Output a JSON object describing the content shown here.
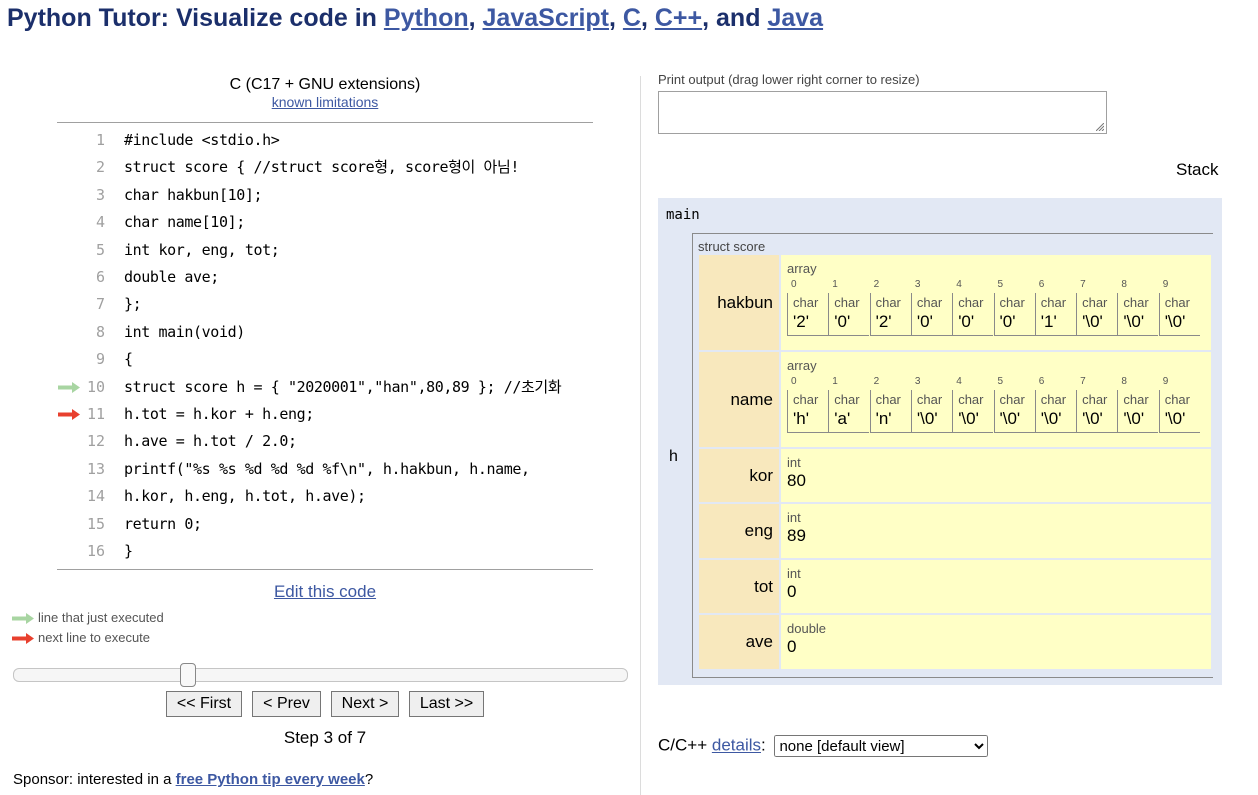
{
  "header": {
    "prefix": "Python Tutor: Visualize code in ",
    "links": [
      "Python",
      "JavaScript",
      "C",
      "C++",
      "Java"
    ],
    "sep": ", ",
    "and": ", and "
  },
  "editor": {
    "language": "C (C17 + GNU extensions)",
    "limitations_link": "known limitations",
    "lines": [
      {
        "n": "1",
        "code": "#include <stdio.h>"
      },
      {
        "n": "2",
        "code": "struct score { //struct score형, score형이 아님!"
      },
      {
        "n": "3",
        "code": "char hakbun[10];"
      },
      {
        "n": "4",
        "code": "char name[10];"
      },
      {
        "n": "5",
        "code": "int kor, eng, tot;"
      },
      {
        "n": "6",
        "code": "double ave;"
      },
      {
        "n": "7",
        "code": "};"
      },
      {
        "n": "8",
        "code": "int main(void)"
      },
      {
        "n": "9",
        "code": "{"
      },
      {
        "n": "10",
        "code": "struct score h = { \"2020001\",\"han\",80,89 }; //초기화"
      },
      {
        "n": "11",
        "code": "h.tot = h.kor + h.eng;"
      },
      {
        "n": "12",
        "code": "h.ave = h.tot / 2.0;"
      },
      {
        "n": "13",
        "code": "printf(\"%s %s %d %d %d %f\\n\", h.hakbun, h.name,"
      },
      {
        "n": "14",
        "code": "h.kor, h.eng, h.tot, h.ave);"
      },
      {
        "n": "15",
        "code": "return 0;"
      },
      {
        "n": "16",
        "code": "}"
      }
    ],
    "edit_link": "Edit this code"
  },
  "legend": {
    "executed": "line that just executed",
    "next": "next line to execute",
    "executed_color": "#a8d5a2",
    "next_color": "#e8402e"
  },
  "navigation": {
    "first": "<< First",
    "prev": "< Prev",
    "next": "Next >",
    "last": "Last >>",
    "step_text": "Step 3 of 7",
    "current_step": 3,
    "total_steps": 7
  },
  "sponsor": {
    "prefix": "Sponsor: interested in a ",
    "link": "free Python tip every week",
    "suffix": "?"
  },
  "output": {
    "print_label": "Print output (drag lower right corner to resize)",
    "print_value": "",
    "stack_label": "Stack"
  },
  "frame": {
    "name": "main",
    "var_name": "h",
    "struct_type": "struct score",
    "fields": [
      {
        "name": "hakbun",
        "kind": "array",
        "type_label": "array",
        "cells": [
          {
            "idx": "0",
            "type": "char",
            "val": "'2'"
          },
          {
            "idx": "1",
            "type": "char",
            "val": "'0'"
          },
          {
            "idx": "2",
            "type": "char",
            "val": "'2'"
          },
          {
            "idx": "3",
            "type": "char",
            "val": "'0'"
          },
          {
            "idx": "4",
            "type": "char",
            "val": "'0'"
          },
          {
            "idx": "5",
            "type": "char",
            "val": "'0'"
          },
          {
            "idx": "6",
            "type": "char",
            "val": "'1'"
          },
          {
            "idx": "7",
            "type": "char",
            "val": "'\\0'"
          },
          {
            "idx": "8",
            "type": "char",
            "val": "'\\0'"
          },
          {
            "idx": "9",
            "type": "char",
            "val": "'\\0'"
          }
        ]
      },
      {
        "name": "name",
        "kind": "array",
        "type_label": "array",
        "cells": [
          {
            "idx": "0",
            "type": "char",
            "val": "'h'"
          },
          {
            "idx": "1",
            "type": "char",
            "val": "'a'"
          },
          {
            "idx": "2",
            "type": "char",
            "val": "'n'"
          },
          {
            "idx": "3",
            "type": "char",
            "val": "'\\0'"
          },
          {
            "idx": "4",
            "type": "char",
            "val": "'\\0'"
          },
          {
            "idx": "5",
            "type": "char",
            "val": "'\\0'"
          },
          {
            "idx": "6",
            "type": "char",
            "val": "'\\0'"
          },
          {
            "idx": "7",
            "type": "char",
            "val": "'\\0'"
          },
          {
            "idx": "8",
            "type": "char",
            "val": "'\\0'"
          },
          {
            "idx": "9",
            "type": "char",
            "val": "'\\0'"
          }
        ]
      },
      {
        "name": "kor",
        "kind": "scalar",
        "type_label": "int",
        "value": "80"
      },
      {
        "name": "eng",
        "kind": "scalar",
        "type_label": "int",
        "value": "89"
      },
      {
        "name": "tot",
        "kind": "scalar",
        "type_label": "int",
        "value": "0"
      },
      {
        "name": "ave",
        "kind": "scalar",
        "type_label": "double",
        "value": "0"
      }
    ]
  },
  "details": {
    "prefix": "C/C++ ",
    "link": "details",
    "suffix": ":",
    "selected": "none [default view]"
  }
}
